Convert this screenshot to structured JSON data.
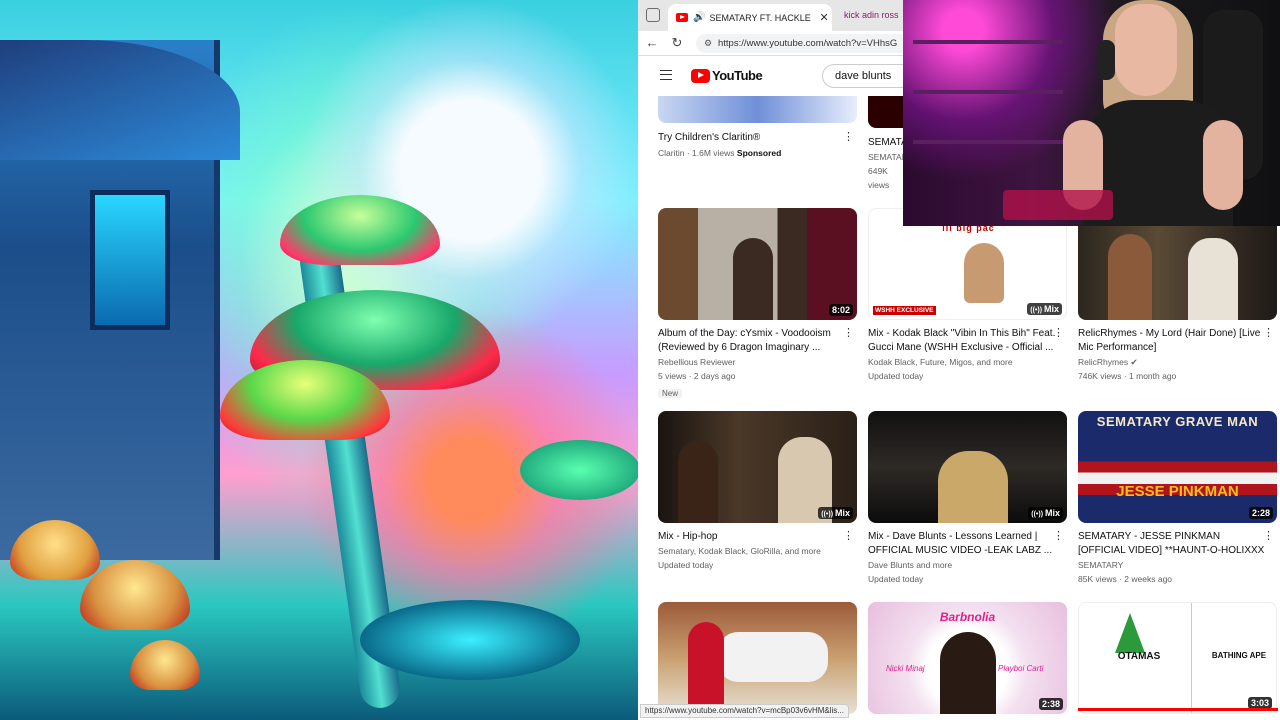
{
  "browser": {
    "active_tab_title": "SEMATARY FT. HACKLE - HAUNT",
    "other_tab_title": "kick adin ross",
    "url": "https://www.youtube.com/watch?v=VHhsG",
    "status_url": "https://www.youtube.com/watch?v=mcBp03v6vHM&lis..."
  },
  "youtube": {
    "logo_text": "YouTube",
    "search_value": "dave blunts"
  },
  "videos": [
    {
      "title": "Try Children's Claritin®",
      "channel": "Claritin",
      "stats": "1.6M views",
      "extra": "Sponsored",
      "badge": "",
      "duration": ""
    },
    {
      "title": "SEMATA",
      "channel": "SEMATAR",
      "stats": "649K views",
      "extra": "",
      "badge": "",
      "duration": ""
    },
    {
      "title": "Album of the Day: cYsmix - Voodooism (Reviewed by 6 Dragon Imaginary ...",
      "channel": "Rebellious Reviewer",
      "stats": "5 views · 2 days ago",
      "extra": "",
      "badge": "New",
      "duration": "8:02"
    },
    {
      "title": "Mix - Kodak Black \"Vibin In This Bih\" Feat. Gucci Mane (WSHH Exclusive - Official ...",
      "channel": "Kodak Black, Future, Migos, and more",
      "stats": "Updated today",
      "extra": "",
      "badge": "",
      "duration": "Mix"
    },
    {
      "title": "RelicRhymes - My Lord (Hair Done) [Live Mic Performance]",
      "channel": "RelicRhymes",
      "stats": "746K views · 1 month ago",
      "extra": "",
      "badge": "",
      "duration": ""
    },
    {
      "title": "Mix - Hip-hop",
      "channel": "Sematary, Kodak Black, GloRilla, and more",
      "stats": "Updated today",
      "extra": "",
      "badge": "",
      "duration": "Mix"
    },
    {
      "title": "Mix - Dave Blunts - Lessons Learned | OFFICIAL MUSIC VIDEO -LEAK LABZ ...",
      "channel": "Dave Blunts and more",
      "stats": "Updated today",
      "extra": "",
      "badge": "",
      "duration": "Mix"
    },
    {
      "title": "SEMATARY - JESSE PINKMAN [OFFICIAL VIDEO] **HAUNT-O-HOLIXXX ...",
      "channel": "SEMATARY",
      "stats": "85K views · 2 weeks ago",
      "extra": "",
      "badge": "",
      "duration": "2:28"
    },
    {
      "title": "",
      "channel": "",
      "stats": "",
      "extra": "",
      "badge": "",
      "duration": ""
    },
    {
      "title": "",
      "channel": "",
      "stats": "",
      "extra": "",
      "badge": "",
      "duration": "2:38"
    },
    {
      "title": "",
      "channel": "",
      "stats": "",
      "extra": "",
      "badge": "",
      "duration": "3:03"
    }
  ],
  "thumb_text": {
    "lil_big_pac": "lil big pac",
    "wshh": "WSHH EXCLUSIVE",
    "sematary_grave_man": "SEMATARY GRAVE MAN",
    "jesse_pinkman": "JESSE PINKMAN",
    "barbnolia": "Barbnolia",
    "nicki": "Nicki Minaj",
    "playboi": "Playboi Carti",
    "otamas": "OTAMAS",
    "bathing_ape": "BATHING APE"
  },
  "colors": {
    "youtube_red": "#ff0000",
    "link_accent": "#8a1c6a"
  }
}
